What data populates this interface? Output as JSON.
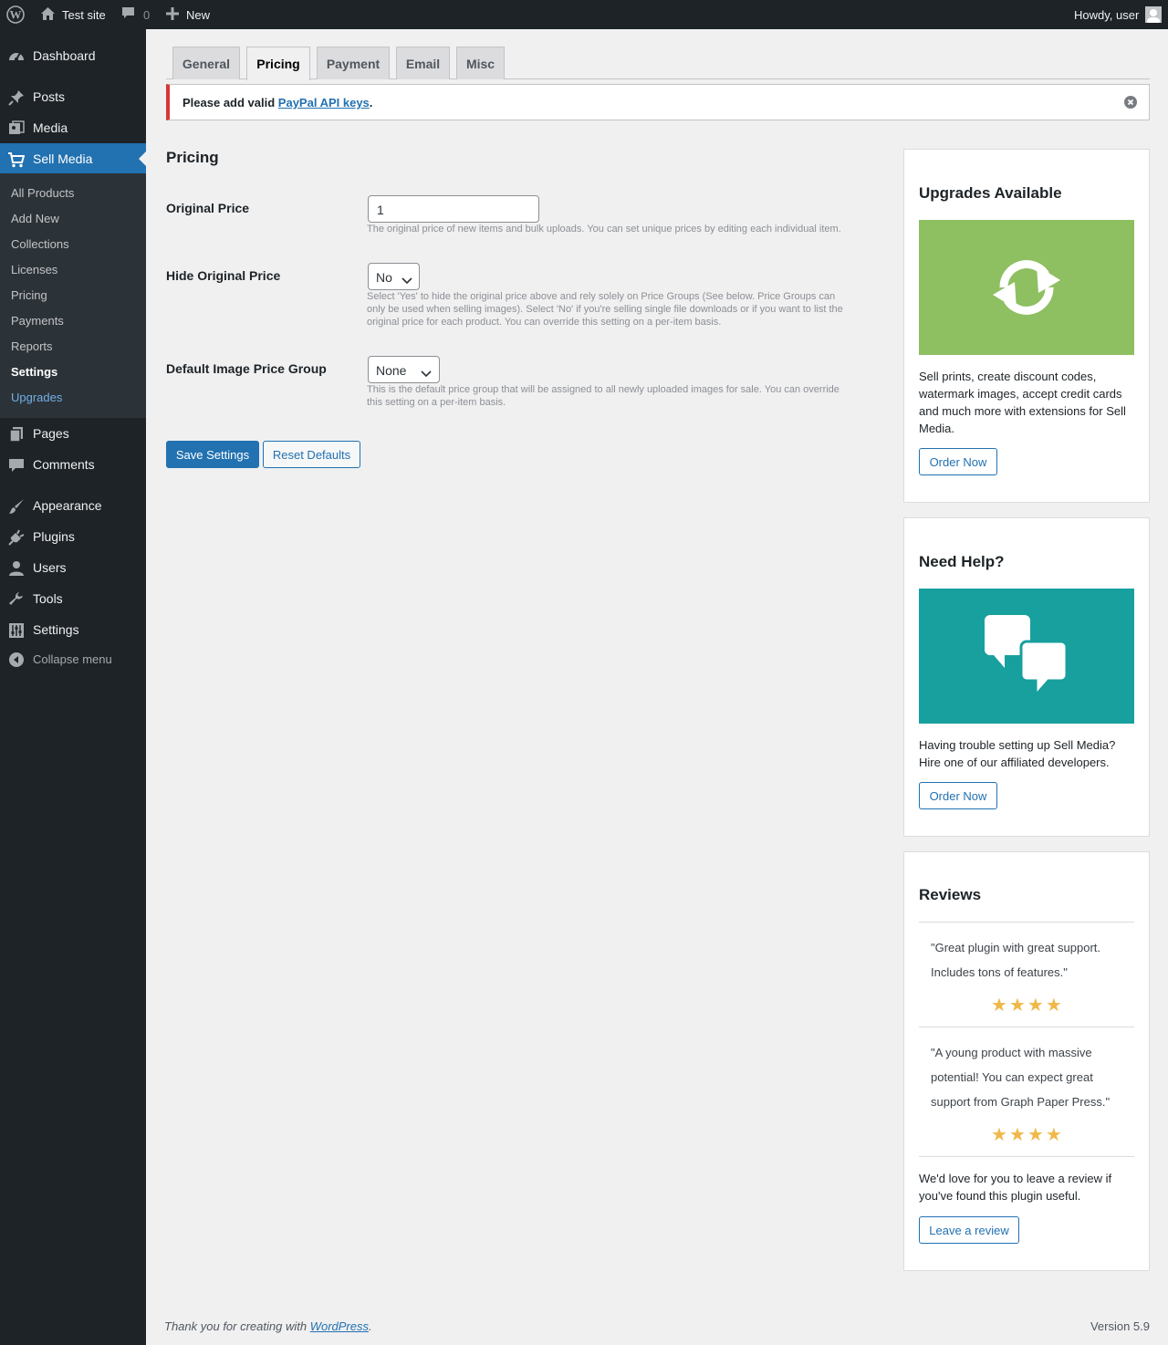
{
  "adminbar": {
    "site_name": "Test site",
    "comments_count": "0",
    "new_label": "New",
    "greeting": "Howdy, user"
  },
  "sidebar": {
    "items": [
      {
        "label": "Dashboard",
        "icon": "dashboard-icon"
      },
      {
        "label": "Posts",
        "icon": "pin-icon"
      },
      {
        "label": "Media",
        "icon": "media-icon"
      },
      {
        "label": "Sell Media",
        "icon": "cart-icon"
      },
      {
        "label": "Pages",
        "icon": "pages-icon"
      },
      {
        "label": "Comments",
        "icon": "comment-icon"
      },
      {
        "label": "Appearance",
        "icon": "brush-icon"
      },
      {
        "label": "Plugins",
        "icon": "plug-icon"
      },
      {
        "label": "Users",
        "icon": "user-icon"
      },
      {
        "label": "Tools",
        "icon": "wrench-icon"
      },
      {
        "label": "Settings",
        "icon": "sliders-icon"
      }
    ],
    "submenu": [
      "All Products",
      "Add New",
      "Collections",
      "Licenses",
      "Pricing",
      "Payments",
      "Reports",
      "Settings",
      "Upgrades"
    ],
    "collapse_label": "Collapse menu"
  },
  "tabs": [
    "General",
    "Pricing",
    "Payment",
    "Email",
    "Misc"
  ],
  "notice": {
    "prefix": "Please add valid",
    "link": "PayPal API keys",
    "suffix": "."
  },
  "section_title": "Pricing",
  "fields": {
    "original_price": {
      "label": "Original Price",
      "value": "1",
      "desc": "The original price of new items and bulk uploads. You can set unique prices by editing each individual item."
    },
    "hide_price": {
      "label": "Hide Original Price",
      "value": "No",
      "desc": "Select 'Yes' to hide the original price above and rely solely on Price Groups (See below. Price Groups can only be used when selling images). Select 'No' if you're selling single file downloads or if you want to list the original price for each product. You can override this setting on a per-item basis."
    },
    "price_group": {
      "label": "Default Image Price Group",
      "value": "None",
      "desc": "This is the default price group that will be assigned to all newly uploaded images for sale. You can override this setting on a per-item basis."
    }
  },
  "buttons": {
    "save": "Save Settings",
    "reset": "Reset Defaults"
  },
  "upgrades_box": {
    "title": "Upgrades Available",
    "text": "Sell prints, create discount codes, watermark images, accept credit cards and much more with extensions for Sell Media.",
    "button": "Order Now",
    "color": "#8ebf61"
  },
  "help_box": {
    "title": "Need Help?",
    "text": "Having trouble setting up Sell Media? Hire one of our affiliated developers.",
    "button": "Order Now",
    "color": "#17a09e"
  },
  "reviews_box": {
    "title": "Reviews",
    "reviews": [
      {
        "text": "\"Great plugin with great support. Includes tons of features.\"",
        "stars": 4
      },
      {
        "text": "\"A young product with massive potential! You can expect great support from Graph Paper Press.\"",
        "stars": 4
      }
    ],
    "cta_text": "We'd love for you to leave a review if you've found this plugin useful.",
    "button": "Leave a review"
  },
  "footer": {
    "thanks_prefix": "Thank you for creating with",
    "thanks_link": "WordPress",
    "thanks_suffix": ".",
    "version": "Version 5.9"
  }
}
